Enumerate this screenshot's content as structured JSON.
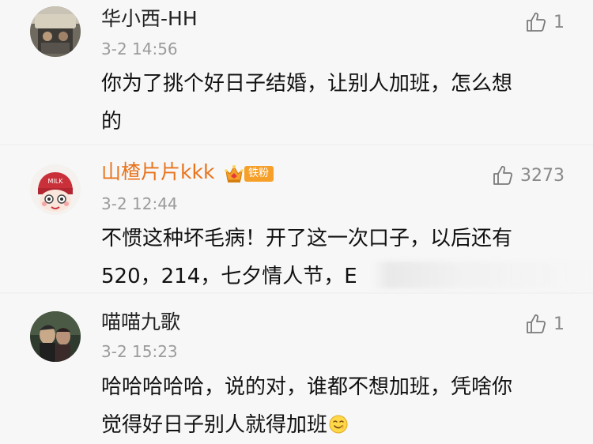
{
  "comments": [
    {
      "username": "华小西-HH",
      "timestamp": "3-2 14:56",
      "likes": "1",
      "content_lines": [
        "你为了挑个好日子结婚，让别人加班，怎么想",
        "的"
      ]
    },
    {
      "username": "山楂片片kkk",
      "badge": "铁粉",
      "timestamp": "3-2 12:44",
      "likes": "3273",
      "content_lines": [
        "不惯这种坏毛病！开了这一次口子，以后还有",
        "520，214，七夕情人节，E"
      ]
    },
    {
      "username": "喵喵九歌",
      "timestamp": "3-2 15:23",
      "likes": "1",
      "content_lines": [
        "哈哈哈哈哈，说的对，谁都不想加班，凭啥你",
        "觉得好日子别人就得加班"
      ]
    }
  ],
  "colors": {
    "vip_username": "#e8731c",
    "badge_bg": "#f6a02a",
    "meta_text": "#9b9b9b",
    "divider": "#e6e6e6"
  },
  "icons": {
    "like": "thumbs-up-icon",
    "crown": "crown-icon",
    "emoji": "smile-emoji-icon"
  }
}
